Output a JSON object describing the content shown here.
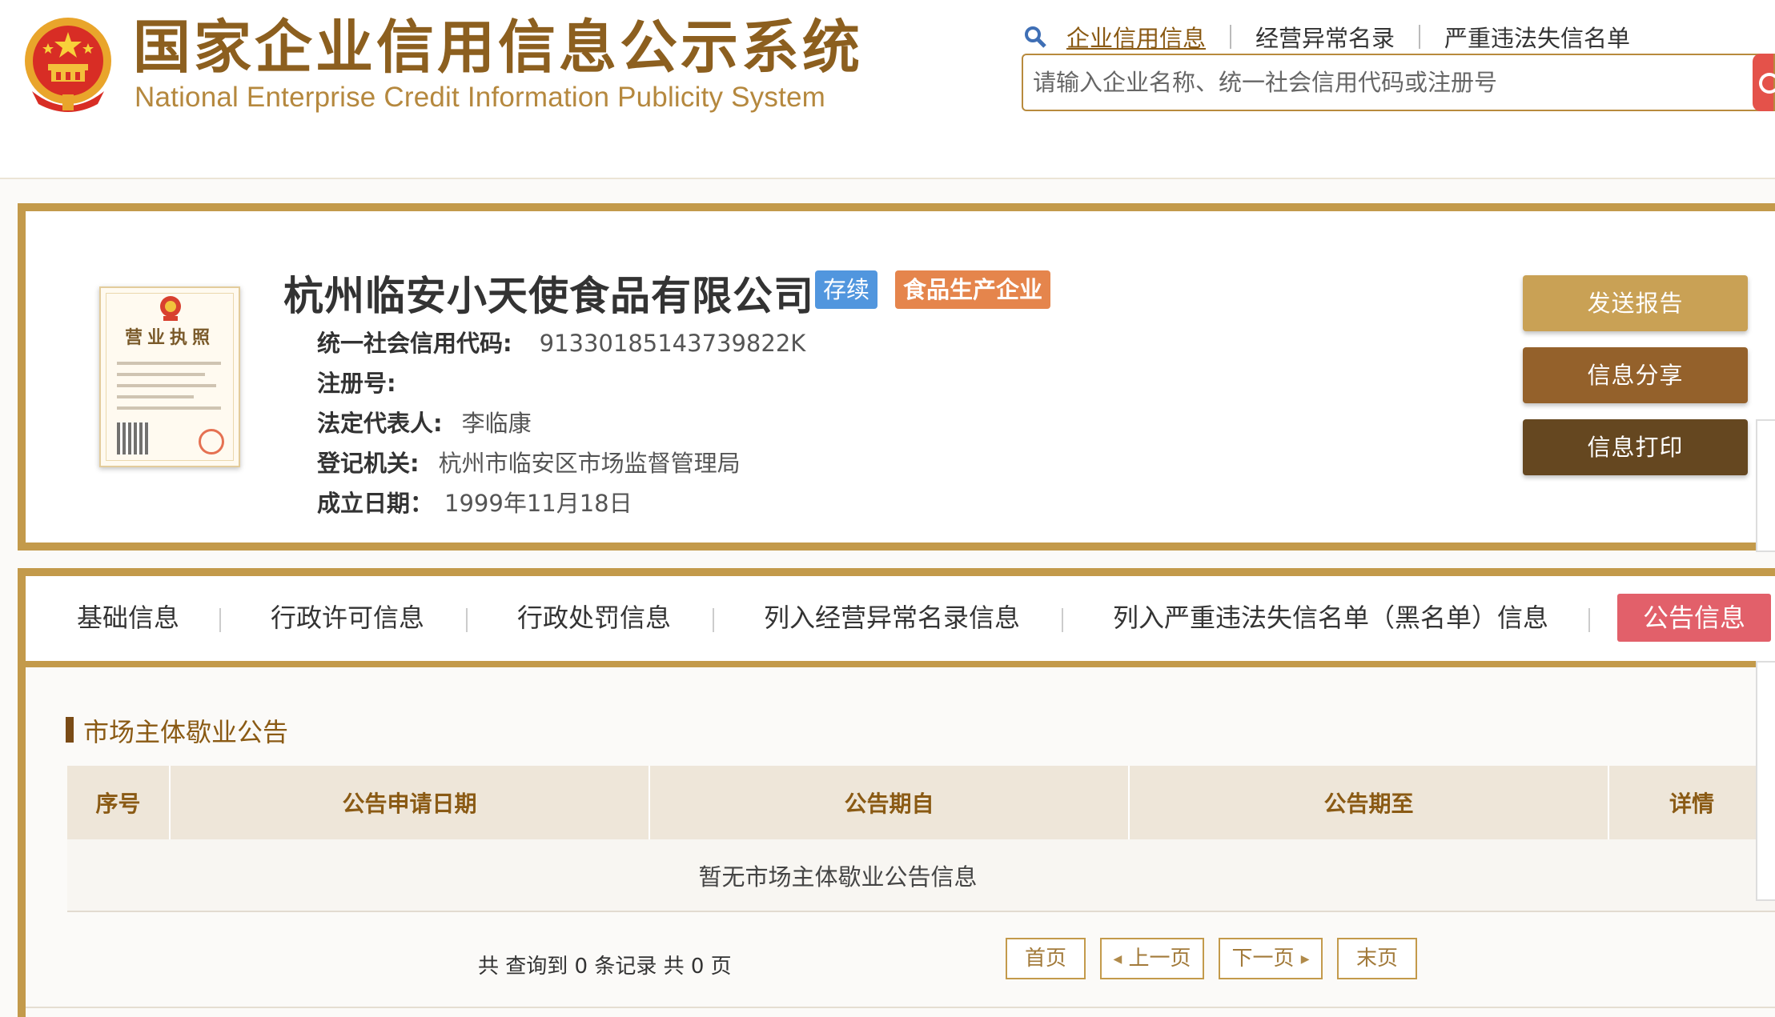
{
  "header": {
    "title_cn": "国家企业信用信息公示系统",
    "title_en": "National Enterprise Credit Information Publicity System",
    "nav": [
      {
        "label": "企业信用信息"
      },
      {
        "label": "经营异常名录"
      },
      {
        "label": "严重违法失信名单"
      }
    ],
    "search_placeholder": "请输入企业名称、统一社会信用代码或注册号"
  },
  "company": {
    "name": "杭州临安小天使食品有限公司",
    "status_badge": "存续",
    "type_badge": "食品生产企业",
    "license_title": "营业执照",
    "fields": [
      {
        "label": "统一社会信用代码:",
        "value": "91330185143739822K"
      },
      {
        "label": "注册号:",
        "value": ""
      },
      {
        "label": "法定代表人:",
        "value": "李临康"
      },
      {
        "label": "登记机关:",
        "value": "杭州市临安区市场监督管理局"
      },
      {
        "label": "成立日期：",
        "value": "1999年11月18日"
      }
    ],
    "actions": {
      "send": "发送报告",
      "share": "信息分享",
      "print": "信息打印"
    }
  },
  "tabs": [
    {
      "label": "基础信息"
    },
    {
      "label": "行政许可信息"
    },
    {
      "label": "行政处罚信息"
    },
    {
      "label": "列入经营异常名录信息"
    },
    {
      "label": "列入严重违法失信名单（黑名单）信息"
    },
    {
      "label": "公告信息"
    }
  ],
  "notice": {
    "section_title": "市场主体歇业公告",
    "columns": [
      "序号",
      "公告申请日期",
      "公告期自",
      "公告期至",
      "详情"
    ],
    "empty_text": "暂无市场主体歇业公告信息"
  },
  "pager": {
    "summary": "共 查询到 0 条记录 共 0 页",
    "first": "首页",
    "prev": "上一页",
    "next": "下一页",
    "last": "末页"
  },
  "colors": {
    "brand_gold": "#c39a4b",
    "title_brown": "#8c5f1f",
    "active_tab": "#e2606a",
    "status_blue": "#5196de",
    "type_orange": "#e5854c"
  }
}
